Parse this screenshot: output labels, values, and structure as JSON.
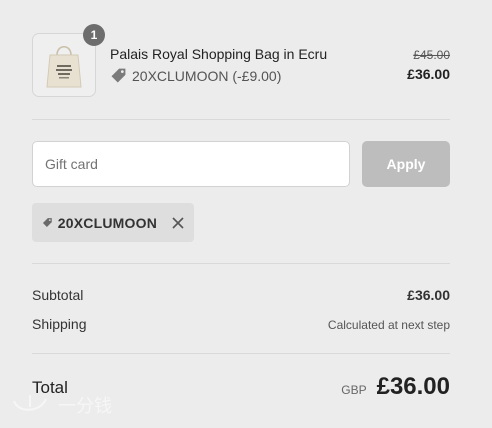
{
  "line_item": {
    "quantity": "1",
    "title": "Palais Royal Shopping Bag in Ecru",
    "discount_code": "20XCLUMOON (-£9.00)",
    "original_price": "£45.00",
    "price": "£36.00"
  },
  "gift_card": {
    "placeholder": "Gift card",
    "apply_label": "Apply"
  },
  "applied_code": {
    "label": "20XCLUMOON"
  },
  "summary": {
    "subtotal_label": "Subtotal",
    "subtotal_value": "£36.00",
    "shipping_label": "Shipping",
    "shipping_value": "Calculated at next step",
    "total_label": "Total",
    "currency": "GBP",
    "total_value": "£36.00"
  },
  "watermark": {
    "text": "一分钱"
  },
  "icons": {
    "tag": "tag-icon",
    "close": "close-icon",
    "product": "tote-bag-image"
  },
  "colors": {
    "apply_disabled": "#bdbdbd",
    "badge": "#6d6d6d",
    "chip_bg": "#dedede"
  }
}
